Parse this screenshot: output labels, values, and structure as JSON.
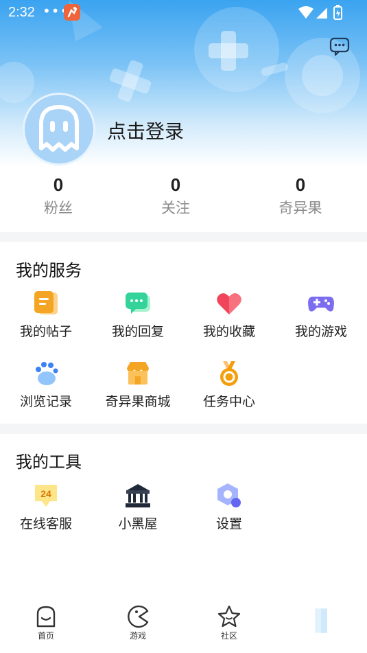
{
  "status_bar": {
    "time": "2:32",
    "dots": "•••"
  },
  "profile": {
    "login_prompt": "点击登录"
  },
  "stats": [
    {
      "value": "0",
      "label": "粉丝"
    },
    {
      "value": "0",
      "label": "关注"
    },
    {
      "value": "0",
      "label": "奇异果"
    }
  ],
  "services": {
    "title": "我的服务",
    "items": [
      {
        "label": "我的帖子",
        "icon": "posts-icon"
      },
      {
        "label": "我的回复",
        "icon": "reply-icon"
      },
      {
        "label": "我的收藏",
        "icon": "heart-icon"
      },
      {
        "label": "我的游戏",
        "icon": "gamepad-icon"
      },
      {
        "label": "浏览记录",
        "icon": "paw-icon"
      },
      {
        "label": "奇异果商城",
        "icon": "shop-icon"
      },
      {
        "label": "任务中心",
        "icon": "medal-icon"
      }
    ]
  },
  "tools": {
    "title": "我的工具",
    "items": [
      {
        "label": "在线客服",
        "icon": "support-24-icon",
        "badge": "24"
      },
      {
        "label": "小黑屋",
        "icon": "jail-building-icon"
      },
      {
        "label": "设置",
        "icon": "settings-hexagon-icon"
      }
    ]
  },
  "tabbar": {
    "items": [
      {
        "label": "首页",
        "icon": "home-icon"
      },
      {
        "label": "游戏",
        "icon": "pacman-icon"
      },
      {
        "label": "社区",
        "icon": "star-icon"
      },
      {
        "label": "",
        "icon": "profile-tab-icon"
      }
    ]
  },
  "colors": {
    "header_blue": "#3aa3f0",
    "avatar_bg": "#a9d3f7",
    "orange": "#f5a524",
    "green": "#34d399",
    "red": "#f0455a",
    "purple": "#7c6cf0"
  }
}
